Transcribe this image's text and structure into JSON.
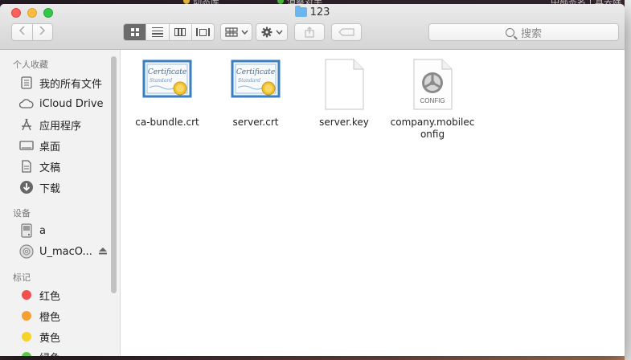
{
  "window": {
    "title": "123"
  },
  "background_hint": {
    "menu_text_1": "动态库",
    "menu_text_2": "消察对手",
    "menu_text_3": "中部签名工具去除"
  },
  "toolbar": {
    "back_icon": "chevron-left-icon",
    "forward_icon": "chevron-right-icon",
    "search_placeholder": "搜索"
  },
  "sidebar": {
    "favorites_title": "个人收藏",
    "favorites": [
      {
        "label": "我的所有文件",
        "icon": "all-files-icon"
      },
      {
        "label": "iCloud Drive",
        "icon": "cloud-icon"
      },
      {
        "label": "应用程序",
        "icon": "applications-icon"
      },
      {
        "label": "桌面",
        "icon": "desktop-icon"
      },
      {
        "label": "文稿",
        "icon": "documents-icon"
      },
      {
        "label": "下载",
        "icon": "download-icon"
      }
    ],
    "devices_title": "设备",
    "devices": [
      {
        "label": "a",
        "icon": "disk-icon"
      },
      {
        "label": "U_macO...",
        "icon": "optical-disk-icon"
      }
    ],
    "tags_title": "标记",
    "tags": [
      {
        "label": "红色",
        "color": "#f0514e"
      },
      {
        "label": "橙色",
        "color": "#f6a032"
      },
      {
        "label": "黄色",
        "color": "#f5d327"
      },
      {
        "label": "绿色",
        "color": "#5ec84b"
      }
    ]
  },
  "files": [
    {
      "name": "ca-bundle.crt",
      "icon": "certificate-icon"
    },
    {
      "name": "server.crt",
      "icon": "certificate-icon"
    },
    {
      "name": "server.key",
      "icon": "blank-document-icon"
    },
    {
      "name": "company.mobileconfig",
      "name_line1": "company.mobilec",
      "name_line2": "onfig",
      "icon": "config-file-icon",
      "badge": "CONFIG"
    }
  ]
}
